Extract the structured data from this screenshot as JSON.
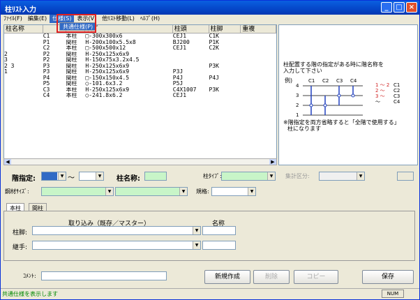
{
  "window": {
    "title": "柱ﾘｽﾄ入力"
  },
  "menu": [
    "ﾌｧｲﾙ(F)",
    "編集(E)",
    "仕様(S)",
    "表示(V)",
    "他ﾘｽﾄ移動(L)",
    "ﾍﾙﾌﾟ(H)"
  ],
  "dropdown": {
    "item": "共通仕様(P)"
  },
  "list": {
    "headers": [
      "柱名称",
      "",
      "",
      "ｻｲｽﾞ",
      "柱頭",
      "柱脚",
      "重複"
    ],
    "rows": [
      [
        "",
        "C1",
        "本柱",
        "□-300x300x6",
        "CEJ1",
        "C1K",
        ""
      ],
      [
        "",
        "P1",
        "間柱",
        "H-200x100x5.5x8",
        "BJ200",
        "P1K",
        ""
      ],
      [
        "",
        "C2",
        "本柱",
        "□-500x500x12",
        "CEJ1",
        "C2K",
        ""
      ],
      [
        "2",
        "P2",
        "間柱",
        "H-250x125x6x9",
        "",
        "",
        ""
      ],
      [
        "3",
        "P2",
        "間柱",
        "H-150x75x3.2x4.5",
        "",
        "",
        ""
      ],
      [
        "2  3",
        "P3",
        "間柱",
        "H-250x125x6x9",
        "",
        "P3K",
        ""
      ],
      [
        "1",
        "P3",
        "間柱",
        "H-250x125x6x9",
        "P3J",
        "",
        ""
      ],
      [
        "",
        "P4",
        "間柱",
        "□-150x150x4.5",
        "P4J",
        "P4J",
        ""
      ],
      [
        "",
        "P5",
        "間柱",
        "○-101.6x3.2",
        "P5J",
        "",
        ""
      ],
      [
        "",
        "C3",
        "本柱",
        "H-250x125x6x9",
        "C4X1007",
        "P3K",
        ""
      ],
      [
        "",
        "C4",
        "本柱",
        "○-241.8x6.2",
        "CEJ1",
        "",
        ""
      ]
    ]
  },
  "help": {
    "line1": "柱配置する階の指定がある時に階名称を",
    "line2": "入力して下さい",
    "example": "例)",
    "cols": [
      "C1",
      "C2",
      "C3",
      "C4"
    ],
    "floors": [
      "4",
      "3",
      "2",
      "1"
    ],
    "legend": [
      "1 ～ 2",
      "2 ～",
      "3 ～",
      "～"
    ],
    "legend_names": [
      "C1",
      "C2",
      "C3",
      "C4"
    ],
    "note1": "※階指定を両方省略すると「全階で使用する」",
    "note2": "柱になります"
  },
  "form": {
    "floor_label": "階指定:",
    "tilde": "～",
    "name_label": "柱名称:",
    "type_label": "柱ﾀｲﾌﾟ:",
    "calc_label": "集計区分:",
    "steel_label": "鋼材ｻｲｽﾞ:",
    "spec_label": "規格:",
    "tabs": [
      "本柱",
      "間柱"
    ],
    "import_label": "取り込み（既存／マスター）",
    "name_col": "名称",
    "base_label": "柱脚:",
    "joint_label": "継手:",
    "comment_label": "ｺﾒﾝﾄ:"
  },
  "buttons": {
    "new": "新規作成",
    "delete": "削除",
    "copy": "コピー",
    "save": "保存"
  },
  "status": {
    "text": "共通仕様を表示します",
    "num": "NUM"
  }
}
